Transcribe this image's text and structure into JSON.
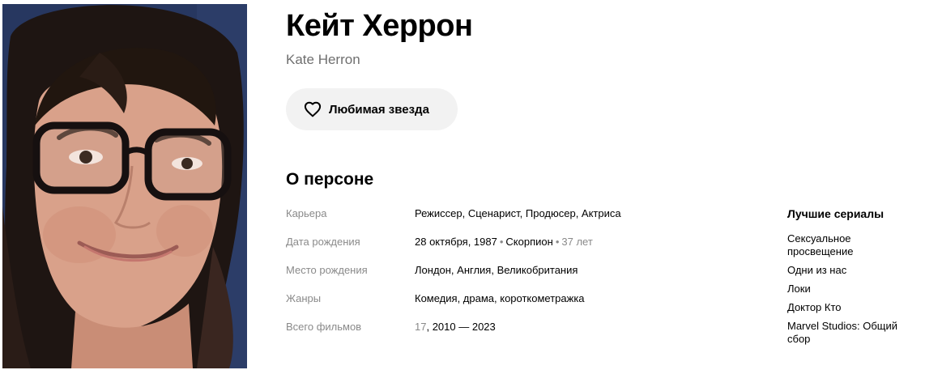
{
  "person": {
    "name": "Кейт Херрон",
    "original_name": "Kate Herron",
    "photo_alt": "Кейт Херрон"
  },
  "actions": {
    "favorite_label": "Любимая звезда",
    "favorite_icon": "heart-outline-icon"
  },
  "about": {
    "title": "О персоне",
    "rows": [
      {
        "key": "Карьера",
        "value": "Режиссер, Сценарист, Продюсер, Актриса"
      },
      {
        "key": "Дата рождения",
        "date": "28 октября, 1987",
        "sign": "Скорпион",
        "age": "37 лет"
      },
      {
        "key": "Место рождения",
        "value": "Лондон, Англия, Великобритания"
      },
      {
        "key": "Жанры",
        "value": "Комедия, драма, короткометражка"
      },
      {
        "key": "Всего фильмов",
        "count": "17",
        "years": ", 2010 — 2023"
      }
    ]
  },
  "best_series": {
    "title": "Лучшие сериалы",
    "items": [
      "Сексуальное просвещение",
      "Одни из нас",
      "Локи",
      "Доктор Кто",
      "Marvel Studios: Общий сбор"
    ]
  },
  "colors": {
    "muted_text": "#8a8a8a",
    "button_bg": "#f2f2f2",
    "secondary_title": "#6f6f6f"
  }
}
